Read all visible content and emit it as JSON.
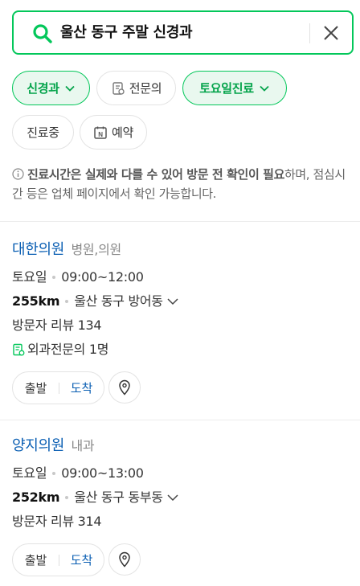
{
  "search": {
    "query": "울산 동구 주말 신경과"
  },
  "filters": [
    {
      "label": "신경과",
      "active": true,
      "dropdown": true
    },
    {
      "label": "전문의",
      "active": false,
      "icon": "specialist-icon"
    },
    {
      "label": "토요일진료",
      "active": true,
      "dropdown": true
    },
    {
      "label": "진료중",
      "active": false
    },
    {
      "label": "예약",
      "active": false,
      "icon": "naver-booking-icon"
    }
  ],
  "notice": {
    "bold": "진료시간은 실제와 다를 수 있어 방문 전 확인이 필요",
    "rest": "하며, 점심시간 등은 업체 페이지에서 확인 가능합니다."
  },
  "results": [
    {
      "name": "대한의원",
      "category": "병원,의원",
      "day": "토요일",
      "hours": "09:00~12:00",
      "distance": "255km",
      "address": "울산 동구 방어동",
      "reviews": "방문자 리뷰 134",
      "specialist": "외과전문의 1명",
      "depart": "출발",
      "arrive": "도착"
    },
    {
      "name": "양지의원",
      "category": "내과",
      "day": "토요일",
      "hours": "09:00~13:00",
      "distance": "252km",
      "address": "울산 동구 동부동",
      "reviews": "방문자 리뷰 314",
      "depart": "출발",
      "arrive": "도착"
    }
  ],
  "colors": {
    "accent": "#03c75a",
    "link": "#0b5fb3"
  }
}
